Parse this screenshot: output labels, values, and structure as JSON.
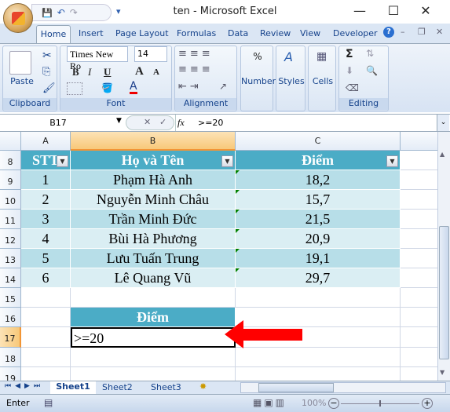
{
  "window": {
    "title": "ten - Microsoft Excel",
    "minimize": "—",
    "maximize": "☐",
    "close": "✕"
  },
  "quick_access": {
    "save": "💾",
    "undo": "↶",
    "redo": "↷",
    "customize": "▾"
  },
  "ribbon_tabs": [
    "Home",
    "Insert",
    "Page Layout",
    "Formulas",
    "Data",
    "Review",
    "View",
    "Developer"
  ],
  "ribbon": {
    "clipboard": {
      "label": "Clipboard",
      "paste": "Paste"
    },
    "font": {
      "label": "Font",
      "font_name": "Times New Ro",
      "font_size": "14",
      "bold": "B",
      "italic": "I",
      "underline": "U",
      "grow": "A",
      "shrink": "A",
      "font_color": "A"
    },
    "alignment": {
      "label": "Alignment"
    },
    "number": {
      "label": "Number",
      "icon": "%"
    },
    "styles": {
      "label": "Styles"
    },
    "cells": {
      "label": "Cells"
    },
    "editing": {
      "label": "Editing",
      "sum": "Σ"
    }
  },
  "formula_bar": {
    "name_box": "B17",
    "fx": "fx",
    "cancel": "✕",
    "enter": "✓",
    "value": ">=20"
  },
  "columns": [
    "A",
    "B",
    "C"
  ],
  "rows_numbers": [
    "8",
    "9",
    "10",
    "11",
    "12",
    "13",
    "14",
    "15",
    "16",
    "17",
    "18",
    "19"
  ],
  "table": {
    "headers": [
      "STT",
      "Họ và Tên",
      "Điểm"
    ],
    "rows": [
      [
        "1",
        "Phạm Hà Anh",
        "18,2"
      ],
      [
        "2",
        "Nguyễn Minh Châu",
        "15,7"
      ],
      [
        "3",
        "Trần Minh Đức",
        "21,5"
      ],
      [
        "4",
        "Bùi Hà Phương",
        "20,9"
      ],
      [
        "5",
        "Lưu Tuấn Trung",
        "19,1"
      ],
      [
        "6",
        "Lê Quang Vũ",
        "29,7"
      ]
    ]
  },
  "criteria": {
    "header": "Điểm",
    "value": ">=20"
  },
  "sheet_tabs": [
    "Sheet1",
    "Sheet2",
    "Sheet3"
  ],
  "active_sheet": "Sheet1",
  "status": {
    "mode": "Enter",
    "zoom": "100%"
  },
  "colors": {
    "table_header": "#4BACC6",
    "band_dark": "#B7DEE8",
    "band_light": "#DAEEF3",
    "arrow": "#FF0000"
  }
}
